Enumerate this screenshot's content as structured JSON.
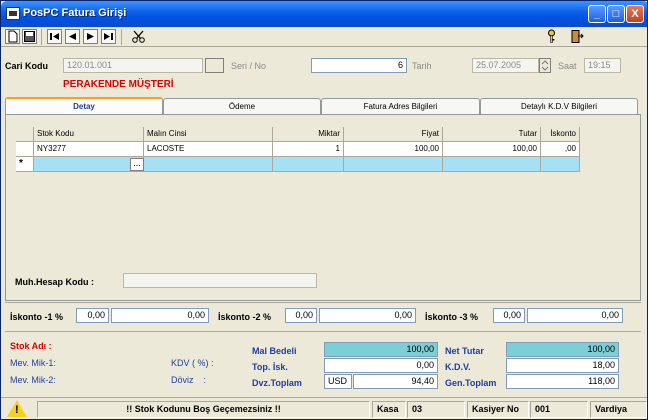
{
  "window": {
    "title": "PosPC Fatura Girişi"
  },
  "titlebar_buttons": {
    "minimize": "_",
    "maximize": "□",
    "close": "X"
  },
  "toolbar": {
    "icons": [
      "new-document-icon",
      "save-icon",
      "first-record-icon",
      "previous-record-icon",
      "next-record-icon",
      "last-record-icon",
      "scissors-icon",
      "key-icon",
      "exit-door-icon"
    ]
  },
  "header": {
    "cari_kodu_label": "Cari Kodu",
    "cari_kodu_value": "120.01.001",
    "seri_no_label": "Seri / No",
    "seri_value": "",
    "no_value": "6",
    "tarih_label": "Tarih",
    "tarih_value": "25.07.2005",
    "saat_label": "Saat",
    "saat_value": "19:15",
    "customer_name": "PERAKENDE MÜŞTERİ"
  },
  "tabs": [
    {
      "label": "Detay",
      "active": true
    },
    {
      "label": "Ödeme",
      "active": false
    },
    {
      "label": "Fatura Adres Bilgileri",
      "active": false
    },
    {
      "label": "Detaylı K.D.V Bilgileri",
      "active": false
    }
  ],
  "grid": {
    "columns": [
      "Stok Kodu",
      "Malın Cinsi",
      "Miktar",
      "Fiyat",
      "Tutar",
      "İskonto"
    ],
    "rows": [
      {
        "stok_kodu": "NY3277",
        "malin_cinsi": "LACOSTE",
        "miktar": "1",
        "fiyat": "100,00",
        "tutar": "100,00",
        "iskonto": ",00"
      }
    ],
    "new_row_marker": "*",
    "ellipsis": "..."
  },
  "muh_hesap": {
    "label": "Muh.Hesap Kodu :",
    "value": ""
  },
  "discounts": [
    {
      "label": "İskonto -1 %",
      "percent": "0,00",
      "amount": "0,00"
    },
    {
      "label": "İskonto -2 %",
      "percent": "0,00",
      "amount": "0,00"
    },
    {
      "label": "İskonto -3 %",
      "percent": "0,00",
      "amount": "0,00"
    }
  ],
  "stock_info": {
    "stok_adi_label": "Stok Adı :",
    "mev_mik1_label": "Mev. Mik-1:",
    "mev_mik2_label": "Mev. Mik-2:",
    "kdv_label": "KDV ( %) :",
    "doviz_label": "Döviz    :"
  },
  "totals": {
    "mal_bedeli_label": "Mal Bedeli",
    "mal_bedeli_value": "100,00",
    "top_isk_label": "Top. İsk.",
    "top_isk_value": "0,00",
    "dvz_toplam_label": "Dvz.Toplam",
    "currency": "USD",
    "dvz_toplam_value": "94,40",
    "net_tutar_label": "Net Tutar",
    "net_tutar_value": "100,00",
    "kdv_label": "K.D.V.",
    "kdv_value": "18,00",
    "gen_toplam_label": "Gen.Toplam",
    "gen_toplam_value": "118,00"
  },
  "status": {
    "message": "!! Stok Kodunu Boş Geçemezsiniz !!",
    "kasa_label": "Kasa",
    "kasa_value": "03",
    "kasiyer_label": "Kasiyer No",
    "kasiyer_value": "001",
    "vardiya_label": "Vardiya"
  },
  "colors": {
    "title_blue": "#0054e3",
    "required_red": "#dd0000",
    "new_row_cyan": "#a6e0f4",
    "total_teal": "#7ccfd4"
  }
}
